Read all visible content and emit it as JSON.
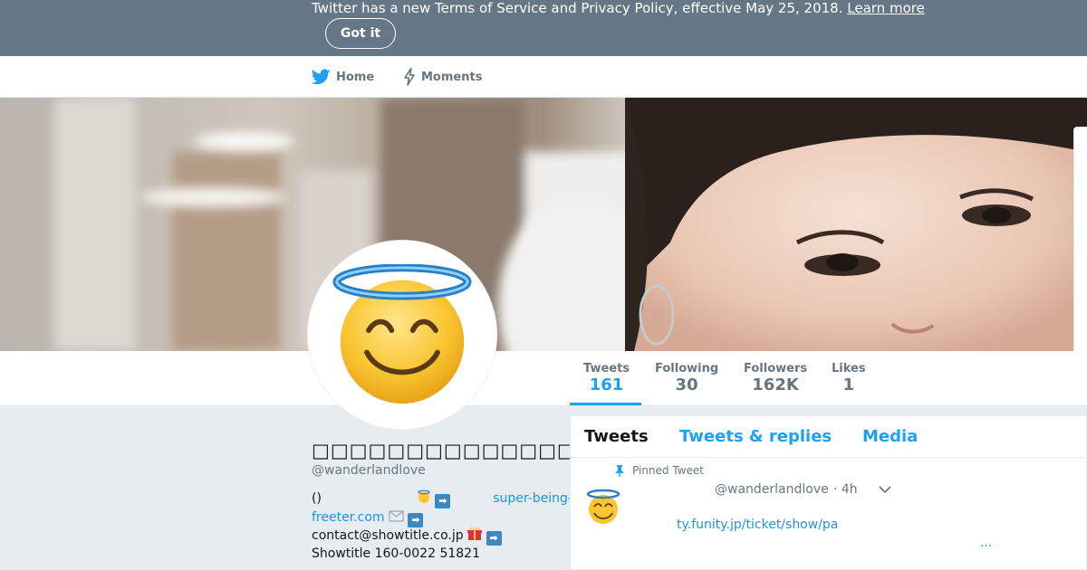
{
  "banner": {
    "message": "Twitter has a new Terms of Service and Privacy Policy, effective May 25, 2018.",
    "link_label": "Learn more",
    "button_label": "Got it"
  },
  "nav": {
    "home_label": "Home",
    "moments_label": "Moments"
  },
  "stats": [
    {
      "label": "Tweets",
      "value": "161"
    },
    {
      "label": "Following",
      "value": "30"
    },
    {
      "label": "Followers",
      "value": "162K"
    },
    {
      "label": "Likes",
      "value": "1"
    }
  ],
  "profile": {
    "name": "□□□□□□□□□□□□□□□□",
    "handle": "@wanderlandlove",
    "bio_line1_prefix": "()",
    "bio_link_a": "super-being-",
    "bio_link_b": "freeter.com",
    "bio_contact": "contact@showtitle.co.jp",
    "bio_line4": "Showtitle 160-0022 51821"
  },
  "timeline": {
    "tabs": [
      "Tweets",
      "Tweets & replies",
      "Media"
    ],
    "pinned_label": "Pinned Tweet",
    "tweet": {
      "handle": "@wanderlandlove",
      "time": "· 4h",
      "link_text": "ty.funity.jp/ticket/show/pa",
      "more": "..."
    }
  },
  "colors": {
    "accent": "#1da1f2",
    "banner_bg": "#657786",
    "link": "#1b95e0"
  },
  "icons": {
    "home": "twitter-bird-icon",
    "moments": "lightning-icon",
    "avatar": "smiling-face-with-halo-icon",
    "pinned": "pin-icon"
  }
}
